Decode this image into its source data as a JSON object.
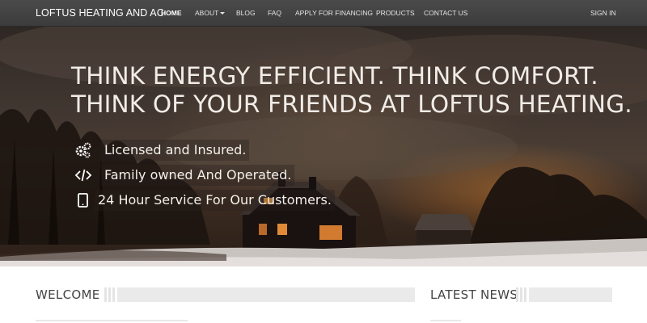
{
  "navbar": {
    "brand": "LOFTUS HEATING AND AC",
    "links": [
      {
        "label": "HOME",
        "active": true
      },
      {
        "label": "ABOUT",
        "dropdown": true
      },
      {
        "label": "BLOG"
      },
      {
        "label": "FAQ"
      },
      {
        "label": "APPLY FOR FINANCING"
      },
      {
        "label": "PRODUCTS"
      },
      {
        "label": "CONTACT US"
      }
    ],
    "signin": "SIGN IN"
  },
  "hero": {
    "headline_line1": "THINK ENERGY EFFICIENT. THINK COMFORT.",
    "headline_line2": "THINK OF YOUR FRIENDS AT LOFTUS HEATING.",
    "features": [
      {
        "icon": "gears-icon",
        "text": "Licensed and Insured."
      },
      {
        "icon": "code-icon",
        "text": "Family owned And Operated."
      },
      {
        "icon": "tablet-icon",
        "text": "24 Hour Service For Our Customers."
      }
    ]
  },
  "sections": {
    "welcome_title": "WELCOME",
    "news_title": "LATEST NEWS"
  },
  "colors": {
    "navbar": "#444444",
    "hero_glow": "#c4762c",
    "section_bar": "#eaeaea"
  }
}
